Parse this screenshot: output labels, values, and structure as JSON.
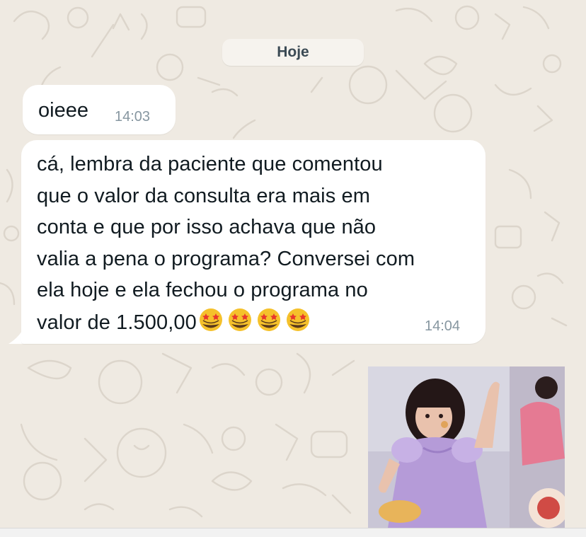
{
  "chat": {
    "date_separator": "Hoje",
    "messages": [
      {
        "text": "oieee",
        "time": "14:03"
      },
      {
        "text": "cá, lembra da paciente que comentou\nque o valor da consulta era mais em\nconta e que por isso achava que não\nvalia a pena o programa? Conversei com\nela hoje e ela fechou o programa no\nvalor de 1.500,00",
        "emoji": [
          "star-struck-emoji",
          "star-struck-emoji",
          "star-struck-emoji",
          "star-struck-emoji"
        ],
        "time": "14:04"
      }
    ],
    "media": {
      "type": "image",
      "icon": "photo-thumbnail"
    }
  },
  "colors": {
    "wallpaper": "#efeae2",
    "bubble_incoming": "#ffffff",
    "timestamp": "#8696a0",
    "date_chip_bg": "#f6f3ee",
    "date_chip_text": "#3b4a54"
  }
}
